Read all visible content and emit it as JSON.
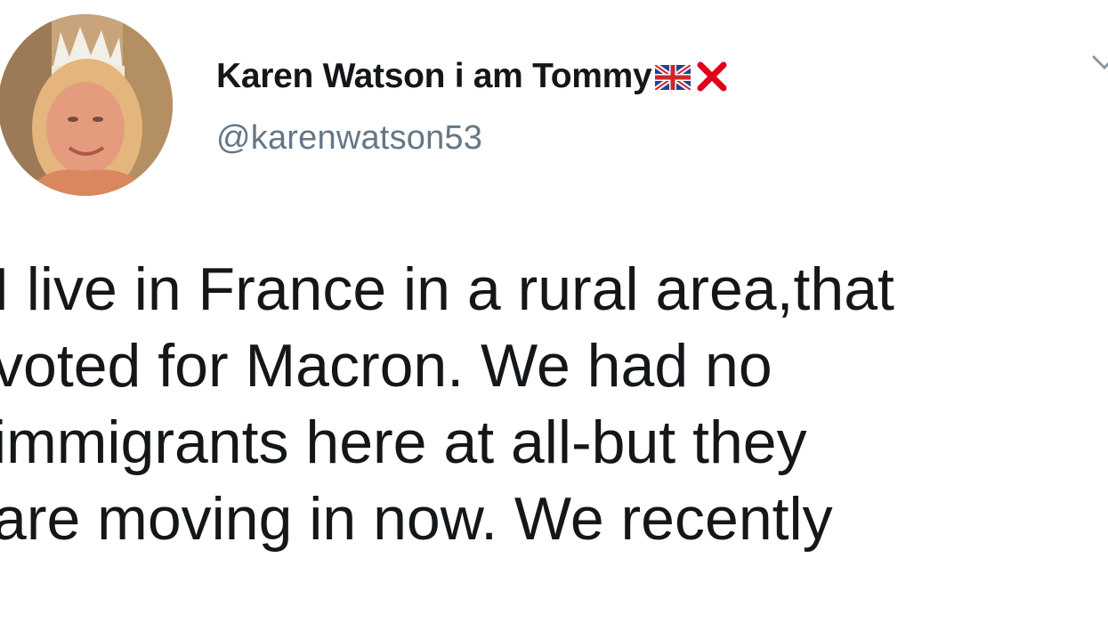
{
  "tweet": {
    "display_name": "Karen Watson i am Tommy",
    "handle": "@karenwatson53",
    "name_icons": [
      "uk-flag-icon",
      "red-cross-icon"
    ],
    "lines": [
      "I live in France in a rural area,that",
      "voted for Macron. We had no",
      "immigrants here at all-but they",
      "are moving in now. We recently"
    ]
  },
  "colors": {
    "name": "#14171a",
    "handle": "#657786",
    "text": "#14171a",
    "cross": "#e0001b",
    "chevron": "#8899a6"
  }
}
